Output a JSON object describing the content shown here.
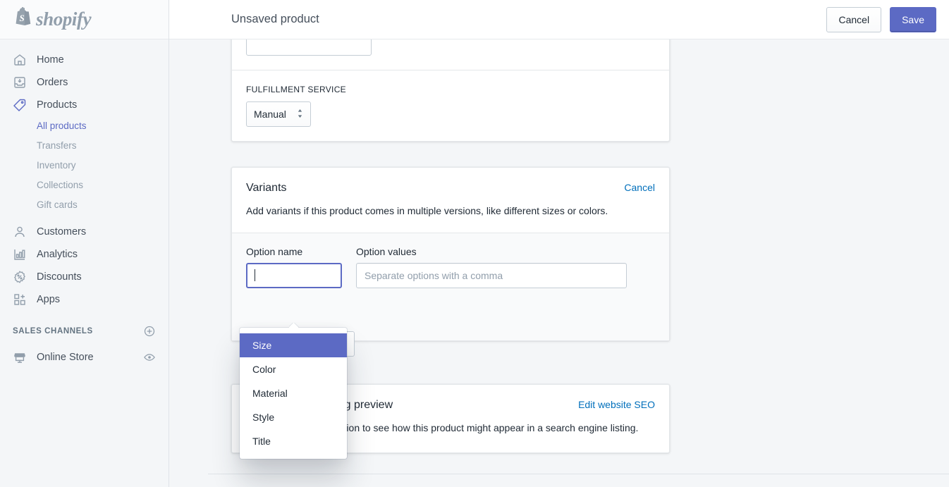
{
  "brand": {
    "name": "shopify",
    "logo_icon": "shopify-bag-logo"
  },
  "sidebar": {
    "nav": [
      {
        "label": "Home",
        "icon": "home-icon",
        "active": false
      },
      {
        "label": "Orders",
        "icon": "orders-inbox-icon",
        "active": false
      },
      {
        "label": "Products",
        "icon": "products-tag-icon",
        "active": true
      }
    ],
    "product_subnav": [
      {
        "label": "All products",
        "active": true
      },
      {
        "label": "Transfers",
        "active": false
      },
      {
        "label": "Inventory",
        "active": false
      },
      {
        "label": "Collections",
        "active": false
      },
      {
        "label": "Gift cards",
        "active": false
      }
    ],
    "nav2": [
      {
        "label": "Customers",
        "icon": "customer-person-icon"
      },
      {
        "label": "Analytics",
        "icon": "analytics-bars-icon"
      },
      {
        "label": "Discounts",
        "icon": "discount-percent-icon"
      },
      {
        "label": "Apps",
        "icon": "apps-grid-plus-icon"
      }
    ],
    "sales_channels": {
      "title": "SALES CHANNELS",
      "add_icon": "plus-circle-icon",
      "items": [
        {
          "label": "Online Store",
          "icon": "storefront-icon",
          "action_icon": "eye-icon"
        }
      ]
    }
  },
  "topbar": {
    "title": "Unsaved product",
    "cancel_label": "Cancel",
    "save_label": "Save"
  },
  "inventory_card": {
    "sku_input_value": "",
    "fulfillment_label": "FULFILLMENT SERVICE",
    "fulfillment_value": "Manual",
    "fulfillment_caret": "⇅"
  },
  "variants_card": {
    "title": "Variants",
    "cancel_label": "Cancel",
    "description": "Add variants if this product comes in multiple versions, like different sizes or colors.",
    "option_name_label": "Option name",
    "option_values_label": "Option values",
    "option_name_value": "",
    "option_values_placeholder": "Separate options with a comma"
  },
  "option_dropdown": {
    "items": [
      {
        "label": "Size",
        "selected": true
      },
      {
        "label": "Color",
        "selected": false
      },
      {
        "label": "Material",
        "selected": false
      },
      {
        "label": "Style",
        "selected": false
      },
      {
        "label": "Title",
        "selected": false
      }
    ]
  },
  "seo_card": {
    "title": "Search engine listing preview",
    "edit_link": "Edit website SEO",
    "description": "Add a title and description to see how this product might appear in a search engine listing."
  },
  "colors": {
    "accent": "#5c6ac4",
    "link": "#006fbb",
    "bg": "#f4f6f8",
    "text": "#212b36",
    "muted": "#919eab"
  }
}
